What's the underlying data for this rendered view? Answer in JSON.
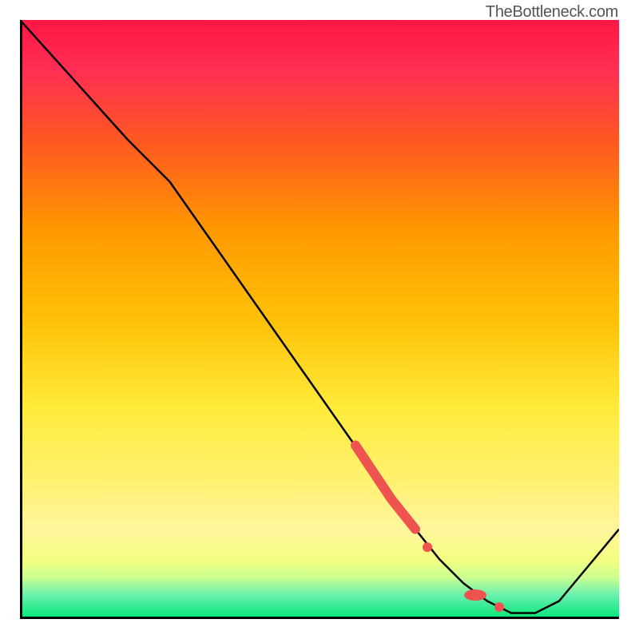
{
  "watermark": "TheBottleneck.com",
  "chart_data": {
    "type": "line",
    "title": "",
    "xlabel": "",
    "ylabel": "",
    "xlim": [
      0,
      100
    ],
    "ylim": [
      0,
      100
    ],
    "series": [
      {
        "name": "bottleneck-curve",
        "x": [
          0,
          18,
          25,
          58,
          62,
          66,
          70,
          74,
          78,
          82,
          86,
          90,
          100
        ],
        "values": [
          100,
          80,
          73,
          26,
          20,
          15,
          10,
          6,
          3,
          1,
          1,
          3,
          15
        ]
      }
    ],
    "markers": [
      {
        "name": "highlight-segment",
        "type": "thick-line",
        "color": "#ef5350",
        "x": [
          56,
          62,
          66
        ],
        "values": [
          29,
          20,
          15
        ]
      },
      {
        "name": "dot-1",
        "type": "dot",
        "color": "#ef5350",
        "x": 68,
        "y": 12
      },
      {
        "name": "dot-cluster",
        "type": "dot-cluster",
        "color": "#ef5350",
        "x": 76,
        "y": 4
      },
      {
        "name": "dot-2",
        "type": "dot",
        "color": "#ef5350",
        "x": 80,
        "y": 2
      }
    ],
    "background_gradient": {
      "top": "#ff1744",
      "mid": "#ffeb3b",
      "bottom": "#00e676"
    }
  }
}
